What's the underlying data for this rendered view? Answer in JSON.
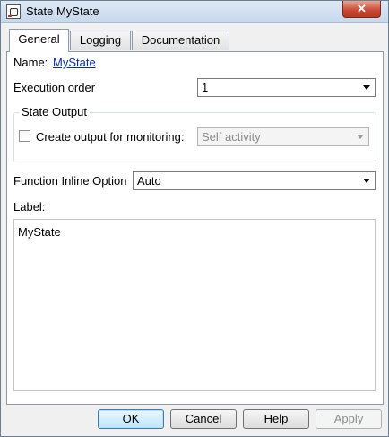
{
  "window": {
    "title": "State MyState",
    "close_label": "✕"
  },
  "tabs": [
    {
      "label": "General",
      "active": true
    },
    {
      "label": "Logging",
      "active": false
    },
    {
      "label": "Documentation",
      "active": false
    }
  ],
  "general": {
    "name_label": "Name:",
    "name_value": "MyState",
    "execution_order_label": "Execution order",
    "execution_order_value": "1",
    "state_output_group": "State Output",
    "create_output_label": "Create output for monitoring:",
    "create_output_checked": false,
    "monitoring_value": "Self activity",
    "function_inline_label": "Function Inline Option",
    "function_inline_value": "Auto",
    "label_label": "Label:",
    "label_text": "MyState"
  },
  "buttons": {
    "ok": "OK",
    "cancel": "Cancel",
    "help": "Help",
    "apply": "Apply"
  },
  "colors": {
    "link": "#0a2ea5",
    "close_button": "#c9472f",
    "default_button_border": "#3c7fb1"
  }
}
